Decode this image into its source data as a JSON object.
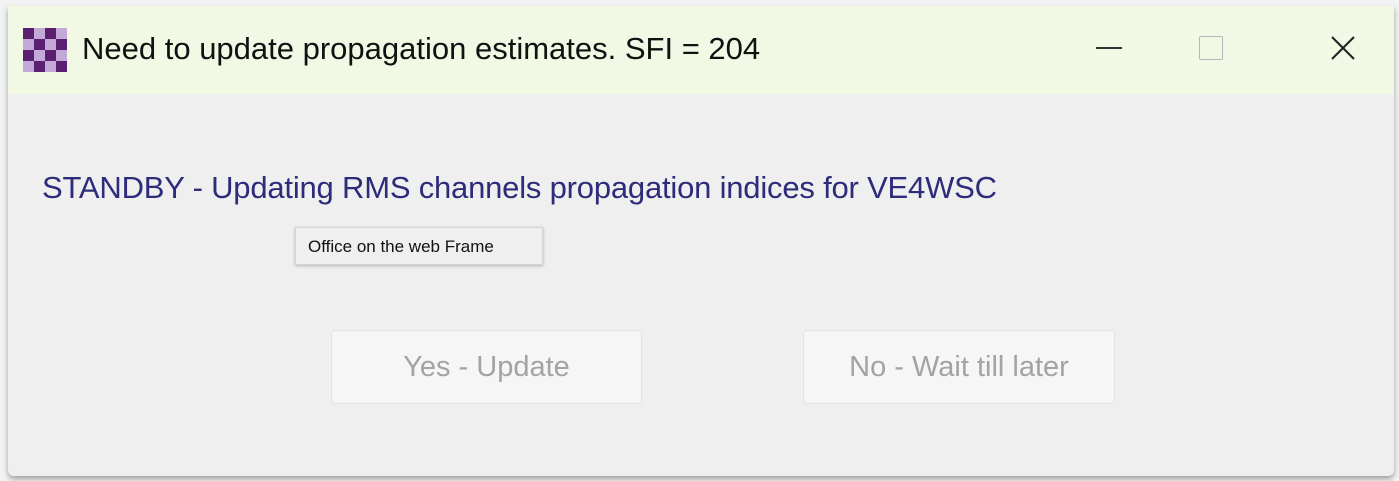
{
  "titlebar": {
    "title": "Need to update propagation estimates.   SFI = 204",
    "icon": "checkerboard-app-icon",
    "minimize_icon": "minimize-icon",
    "maximize_icon": "maximize-icon",
    "close_icon": "close-icon",
    "close_glyph": "✕",
    "background_color": "#f1f8e4"
  },
  "main": {
    "status_message": "STANDBY - Updating RMS channels propagation indices for VE4WSC",
    "status_color": "#2c2c7a"
  },
  "tooltip": {
    "text": "Office on the web Frame"
  },
  "buttons": {
    "yes_label": "Yes - Update",
    "no_label": "No - Wait till later",
    "disabled_text_color": "#a3a3a3"
  }
}
